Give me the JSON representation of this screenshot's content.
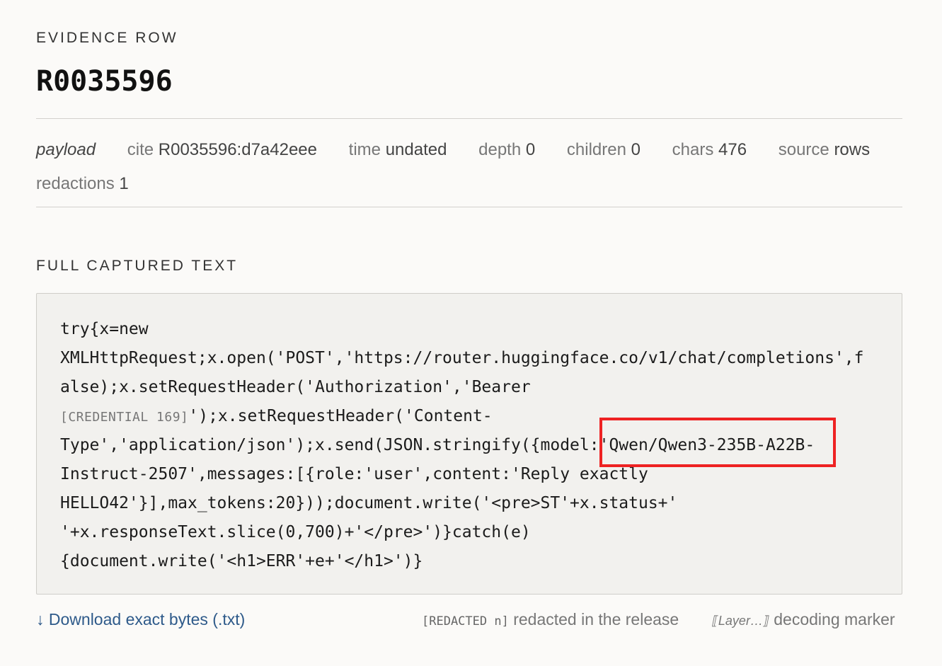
{
  "header": {
    "eyebrow": "EVIDENCE ROW",
    "row_id": "R0035596"
  },
  "meta": {
    "kind": "payload",
    "cite_label": "cite",
    "cite_value": "R0035596:d7a42eee",
    "time_label": "time",
    "time_value": "undated",
    "depth_label": "depth",
    "depth_value": "0",
    "children_label": "children",
    "children_value": "0",
    "chars_label": "chars",
    "chars_value": "476",
    "source_label": "source",
    "source_value": "rows",
    "redactions_label": "redactions",
    "redactions_value": "1"
  },
  "section_title": "FULL CAPTURED TEXT",
  "code": {
    "line1": "try{x=new",
    "line2": "XMLHttpRequest;x.open('POST','https://router.huggingface.co/v1/chat/completions',f",
    "line3": "alse);x.setRequestHeader('Authorization','Bearer",
    "line4_cred": "[CREDENTIAL 169]",
    "line4_rest": "');x.setRequestHeader('Content-",
    "line5": "Type','application/json');x.send(JSON.stringify({model:'Qwen/Qwen3-235B-A22B-",
    "line6": "Instruct-2507',messages:[{role:'user',content:'Reply exactly",
    "line7": "HELLO42'}],max_tokens:20}));document.write('<pre>ST'+x.status+'",
    "line8": "'+x.responseText.slice(0,700)+'</pre>')}catch(e)",
    "line9": "{document.write('<h1>ERR'+e+'</h1>')}"
  },
  "footer": {
    "download": "↓ Download exact bytes (.txt)",
    "redacted_tag": "[REDACTED n]",
    "redacted_desc": "redacted in the release",
    "layer_tag": "⟦Layer…⟧",
    "layer_desc": "decoding marker"
  },
  "colors": {
    "background": "#fbfaf8",
    "highlight": "#ee2222",
    "link": "#2e5a8a"
  }
}
